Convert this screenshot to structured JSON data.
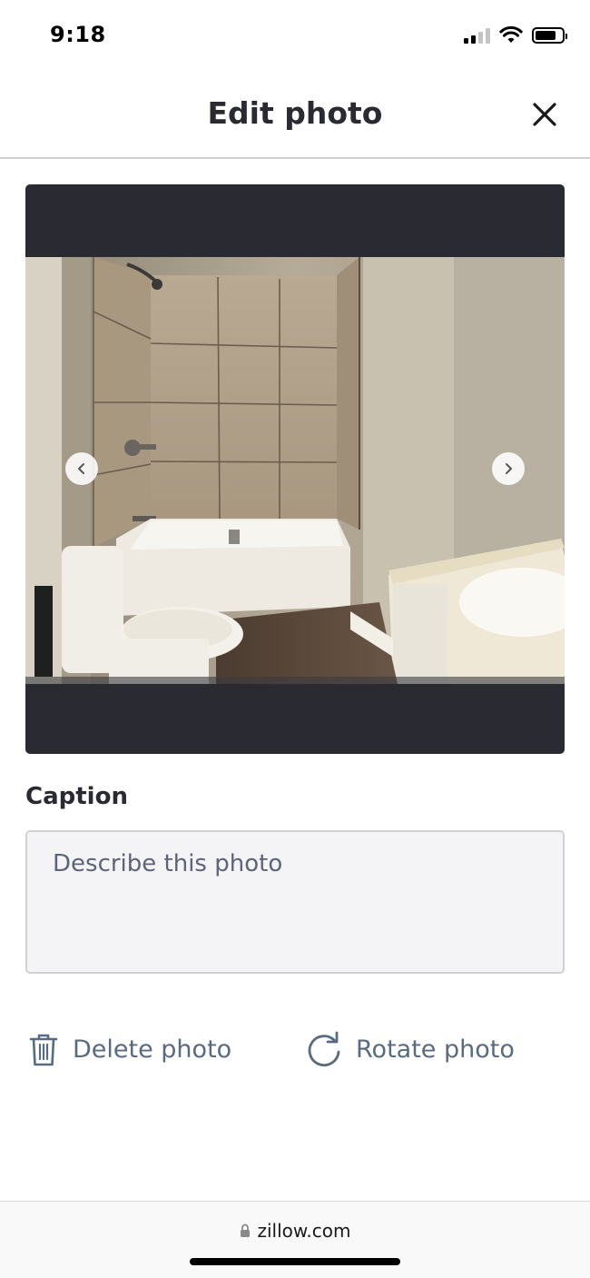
{
  "status_bar": {
    "time": "9:18",
    "signal_icon": "cellular-signal-icon",
    "wifi_icon": "wifi-icon",
    "battery_icon": "battery-icon"
  },
  "header": {
    "title": "Edit photo",
    "close_icon": "close-icon"
  },
  "photo_viewer": {
    "prev_icon": "chevron-left-icon",
    "next_icon": "chevron-right-icon"
  },
  "caption": {
    "label": "Caption",
    "placeholder": "Describe this photo",
    "value": ""
  },
  "actions": {
    "delete_label": "Delete photo",
    "delete_icon": "trash-icon",
    "rotate_label": "Rotate photo",
    "rotate_icon": "rotate-icon"
  },
  "browser": {
    "url": "zillow.com",
    "lock_icon": "lock-icon"
  },
  "colors": {
    "text_dark": "#2a2a33",
    "action_blue_gray": "#596b82",
    "photo_frame_bg": "#2a2a33",
    "input_bg": "#f4f4f7"
  }
}
